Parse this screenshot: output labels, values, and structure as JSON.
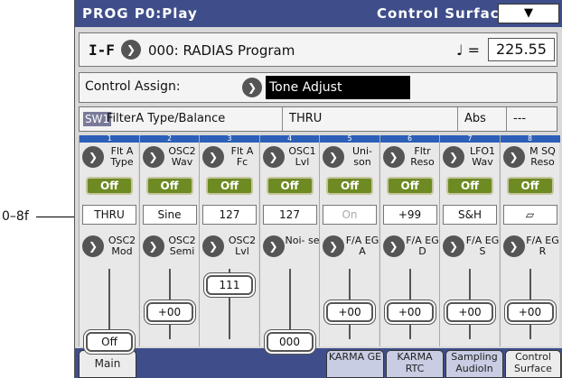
{
  "header": {
    "left": "PROG P0:Play",
    "right": "Control Surface",
    "menu_icon": "chevron-down-icon"
  },
  "program": {
    "bank": "I-F",
    "name": "000: RADIAS Program",
    "tempo_label": "♩ =",
    "tempo": "225.55"
  },
  "assign": {
    "label": "Control Assign:",
    "value": "Tone Adjust"
  },
  "info": {
    "switch": "SW1",
    "param": "FilterA Type/Balance",
    "value": "THRU",
    "mode": "Abs",
    "extra": "---"
  },
  "columns": [
    {
      "num": "1",
      "top": "Flt A Type",
      "sw": "Off",
      "val": "THRU",
      "bottom": "OSC2 Mod",
      "slider": "Off"
    },
    {
      "num": "2",
      "top": "OSC2 Wav",
      "sw": "Off",
      "val": "Sine",
      "bottom": "OSC2 Semi",
      "slider": "+00"
    },
    {
      "num": "3",
      "top": "Flt A Fc",
      "sw": "Off",
      "val": "127",
      "bottom": "OSC2 Lvl",
      "slider": "111"
    },
    {
      "num": "4",
      "top": "OSC1 Lvl",
      "sw": "Off",
      "val": "127",
      "bottom": "Noi- se",
      "slider": "000"
    },
    {
      "num": "5",
      "top": "Uni- son",
      "sw": "Off",
      "val": "On",
      "bottom": "F/A EG A",
      "slider": "+00"
    },
    {
      "num": "6",
      "top": "Fltr Reso",
      "sw": "Off",
      "val": "+99",
      "bottom": "F/A EG D",
      "slider": "+00"
    },
    {
      "num": "7",
      "top": "LFO1 Wav",
      "sw": "Off",
      "val": "S&H",
      "bottom": "F/A EG S",
      "slider": "+00"
    },
    {
      "num": "8",
      "top": "M SQ Reso",
      "sw": "Off",
      "val": "▱",
      "bottom": "F/A EG R",
      "slider": "+00"
    }
  ],
  "slider_levels": [
    0.05,
    0.5,
    0.9,
    0.05,
    0.5,
    0.5,
    0.5,
    0.5
  ],
  "tabs": [
    "Main",
    "",
    "",
    "",
    "KARMA GE",
    "KARMA RTC",
    "Sampling AudioIn",
    "Control Surface"
  ],
  "callout": "0–8f",
  "colors": {
    "header": "#3f4e8a",
    "switch_on": "#6e8a22",
    "column_bar": "#2c5fb8"
  }
}
